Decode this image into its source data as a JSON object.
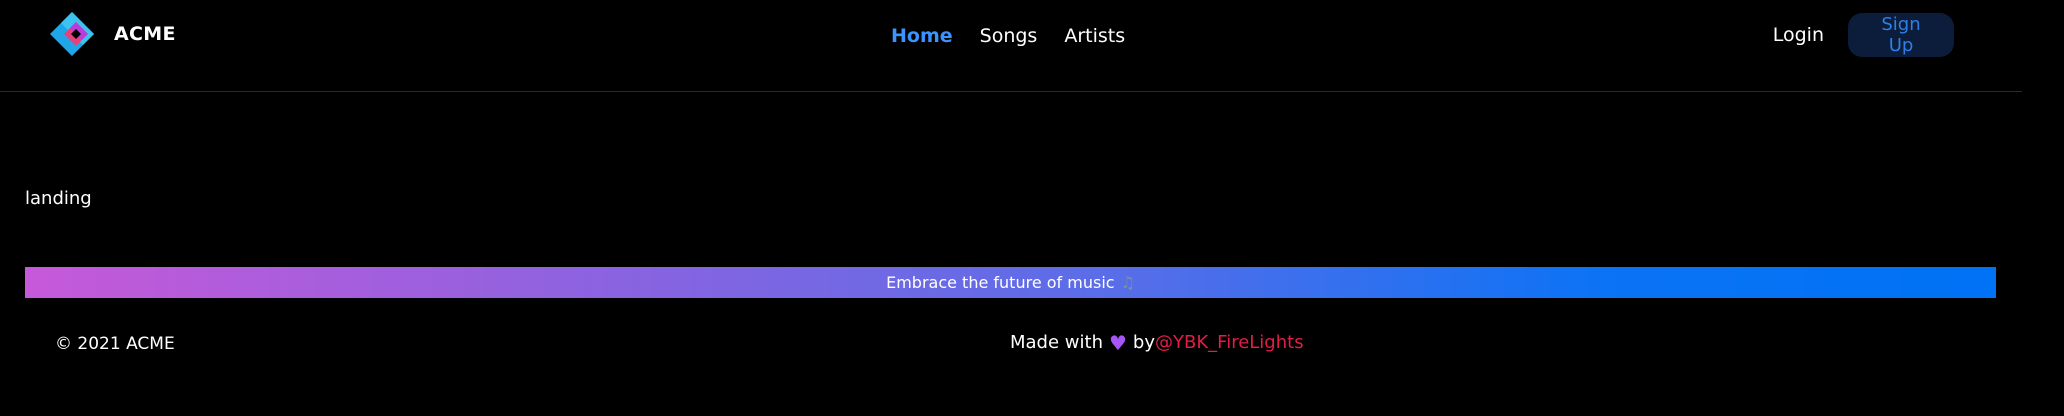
{
  "brand": {
    "name": "ACME",
    "logo_icon": "acme-diamond-logo"
  },
  "nav": {
    "links": [
      {
        "label": "Home",
        "active": true
      },
      {
        "label": "Songs",
        "active": false
      },
      {
        "label": "Artists",
        "active": false
      }
    ],
    "login_label": "Login",
    "signup_label": "Sign Up"
  },
  "main": {
    "text": "landing"
  },
  "banner": {
    "text": "Embrace the future of music",
    "icon": "music-note-icon"
  },
  "footer": {
    "copyright": "© 2021 ACME",
    "made_with_prefix": "Made with",
    "heart_icon": "purple-heart-icon",
    "by_label": "by",
    "author": "@YBK_FireLights"
  },
  "colors": {
    "background": "#000000",
    "accent": "#3b93ff",
    "signup_bg": "#0b1d3a",
    "author": "#e11d48",
    "gradient_start": "#c659d9",
    "gradient_end": "#0072f5"
  }
}
